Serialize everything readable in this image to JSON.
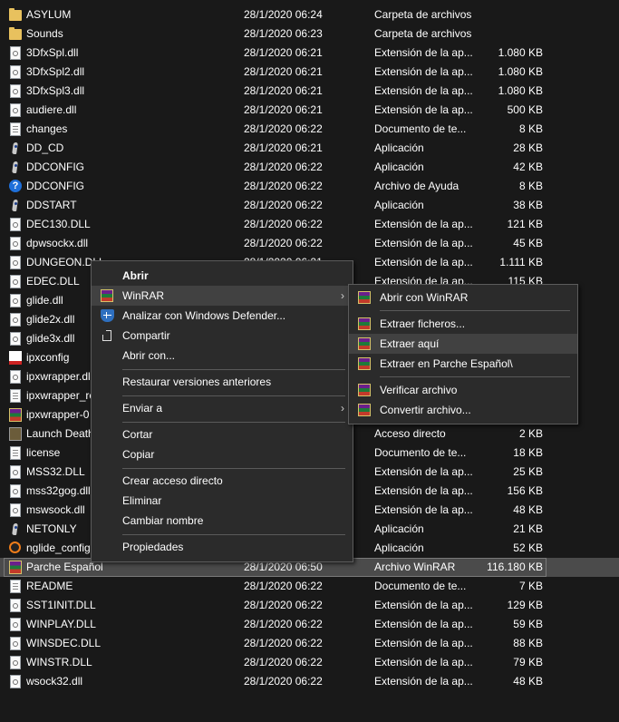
{
  "files": [
    {
      "name": "ASYLUM",
      "date": "28/1/2020 06:24",
      "type": "Carpeta de archivos",
      "size": "",
      "icon": "folder-icon"
    },
    {
      "name": "Sounds",
      "date": "28/1/2020 06:23",
      "type": "Carpeta de archivos",
      "size": "",
      "icon": "folder-icon"
    },
    {
      "name": "3DfxSpl.dll",
      "date": "28/1/2020 06:21",
      "type": "Extensión de la ap...",
      "size": "1.080 KB",
      "icon": "dll-file-icon"
    },
    {
      "name": "3DfxSpl2.dll",
      "date": "28/1/2020 06:21",
      "type": "Extensión de la ap...",
      "size": "1.080 KB",
      "icon": "dll-file-icon"
    },
    {
      "name": "3DfxSpl3.dll",
      "date": "28/1/2020 06:21",
      "type": "Extensión de la ap...",
      "size": "1.080 KB",
      "icon": "dll-file-icon"
    },
    {
      "name": "audiere.dll",
      "date": "28/1/2020 06:21",
      "type": "Extensión de la ap...",
      "size": "500 KB",
      "icon": "dll-file-icon"
    },
    {
      "name": "changes",
      "date": "28/1/2020 06:22",
      "type": "Documento de te...",
      "size": "8 KB",
      "icon": "text-file-icon"
    },
    {
      "name": "DD_CD",
      "date": "28/1/2020 06:21",
      "type": "Aplicación",
      "size": "28 KB",
      "icon": "app-icon"
    },
    {
      "name": "DDCONFIG",
      "date": "28/1/2020 06:22",
      "type": "Aplicación",
      "size": "42 KB",
      "icon": "app-icon"
    },
    {
      "name": "DDCONFIG",
      "date": "28/1/2020 06:22",
      "type": "Archivo de Ayuda",
      "size": "8 KB",
      "icon": "help-file-icon"
    },
    {
      "name": "DDSTART",
      "date": "28/1/2020 06:22",
      "type": "Aplicación",
      "size": "38 KB",
      "icon": "app-icon"
    },
    {
      "name": "DEC130.DLL",
      "date": "28/1/2020 06:22",
      "type": "Extensión de la ap...",
      "size": "121 KB",
      "icon": "dll-file-icon"
    },
    {
      "name": "dpwsockx.dll",
      "date": "28/1/2020 06:22",
      "type": "Extensión de la ap...",
      "size": "45 KB",
      "icon": "dll-file-icon"
    },
    {
      "name": "DUNGEON.DLL",
      "date": "28/1/2020 06:21",
      "type": "Extensión de la ap...",
      "size": "1.111 KB",
      "icon": "dll-file-icon"
    },
    {
      "name": "EDEC.DLL",
      "date": "28/1/2020 06:21",
      "type": "Extensión de la ap...",
      "size": "115 KB",
      "icon": "dll-file-icon"
    },
    {
      "name": "glide.dll",
      "date": "",
      "type": "",
      "size": "",
      "icon": "dll-file-icon"
    },
    {
      "name": "glide2x.dll",
      "date": "",
      "type": "",
      "size": "",
      "icon": "dll-file-icon"
    },
    {
      "name": "glide3x.dll",
      "date": "",
      "type": "",
      "size": "",
      "icon": "dll-file-icon"
    },
    {
      "name": "ipxconfig",
      "date": "",
      "type": "",
      "size": "",
      "icon": "ipx-app-icon"
    },
    {
      "name": "ipxwrapper.dll",
      "date": "",
      "type": "",
      "size": "",
      "icon": "dll-file-icon"
    },
    {
      "name": "ipxwrapper_re",
      "date": "",
      "type": "",
      "size": "",
      "icon": "text-file-icon"
    },
    {
      "name": "ipxwrapper-0",
      "date": "",
      "type": "",
      "size": "",
      "icon": "winrar-archive-icon"
    },
    {
      "name": "Launch Death",
      "date": "",
      "type": "Acceso directo",
      "size": "2 KB",
      "icon": "shortcut-icon"
    },
    {
      "name": "license",
      "date": "",
      "type": "Documento de te...",
      "size": "18 KB",
      "icon": "text-file-icon"
    },
    {
      "name": "MSS32.DLL",
      "date": "",
      "type": "Extensión de la ap...",
      "size": "25 KB",
      "icon": "dll-file-icon"
    },
    {
      "name": "mss32gog.dll",
      "date": "",
      "type": "Extensión de la ap...",
      "size": "156 KB",
      "icon": "dll-file-icon"
    },
    {
      "name": "mswsock.dll",
      "date": "",
      "type": "Extensión de la ap...",
      "size": "48 KB",
      "icon": "dll-file-icon"
    },
    {
      "name": "NETONLY",
      "date": "",
      "type": "Aplicación",
      "size": "21 KB",
      "icon": "app-icon"
    },
    {
      "name": "nglide_config",
      "date": "",
      "type": "Aplicación",
      "size": "52 KB",
      "icon": "nglide-icon"
    },
    {
      "name": "Parche Español",
      "date": "28/1/2020 06:50",
      "type": "Archivo WinRAR",
      "size": "116.180 KB",
      "icon": "winrar-archive-icon",
      "selected": true
    },
    {
      "name": "README",
      "date": "28/1/2020 06:22",
      "type": "Documento de te...",
      "size": "7 KB",
      "icon": "text-file-icon"
    },
    {
      "name": "SST1INIT.DLL",
      "date": "28/1/2020 06:22",
      "type": "Extensión de la ap...",
      "size": "129 KB",
      "icon": "dll-file-icon"
    },
    {
      "name": "WINPLAY.DLL",
      "date": "28/1/2020 06:22",
      "type": "Extensión de la ap...",
      "size": "59 KB",
      "icon": "dll-file-icon"
    },
    {
      "name": "WINSDEC.DLL",
      "date": "28/1/2020 06:22",
      "type": "Extensión de la ap...",
      "size": "88 KB",
      "icon": "dll-file-icon"
    },
    {
      "name": "WINSTR.DLL",
      "date": "28/1/2020 06:22",
      "type": "Extensión de la ap...",
      "size": "79 KB",
      "icon": "dll-file-icon"
    },
    {
      "name": "wsock32.dll",
      "date": "28/1/2020 06:22",
      "type": "Extensión de la ap...",
      "size": "48 KB",
      "icon": "dll-file-icon"
    }
  ],
  "context_menu": {
    "open": "Abrir",
    "winrar": "WinRAR",
    "defender": "Analizar con Windows Defender...",
    "share": "Compartir",
    "open_with": "Abrir con...",
    "restore": "Restaurar versiones anteriores",
    "send_to": "Enviar a",
    "cut": "Cortar",
    "copy": "Copiar",
    "create_shortcut": "Crear acceso directo",
    "delete": "Eliminar",
    "rename": "Cambiar nombre",
    "properties": "Propiedades",
    "arrow": "›"
  },
  "winrar_submenu": {
    "open_with_winrar": "Abrir con WinRAR",
    "extract_files": "Extraer ficheros...",
    "extract_here": "Extraer aquí",
    "extract_to": "Extraer en Parche Español\\",
    "test": "Verificar archivo",
    "convert": "Convertir archivo..."
  },
  "colors": {
    "background": "#191919",
    "menu_background": "#2b2b2b",
    "highlight": "#414141",
    "selected_row": "#4b4b4b"
  }
}
